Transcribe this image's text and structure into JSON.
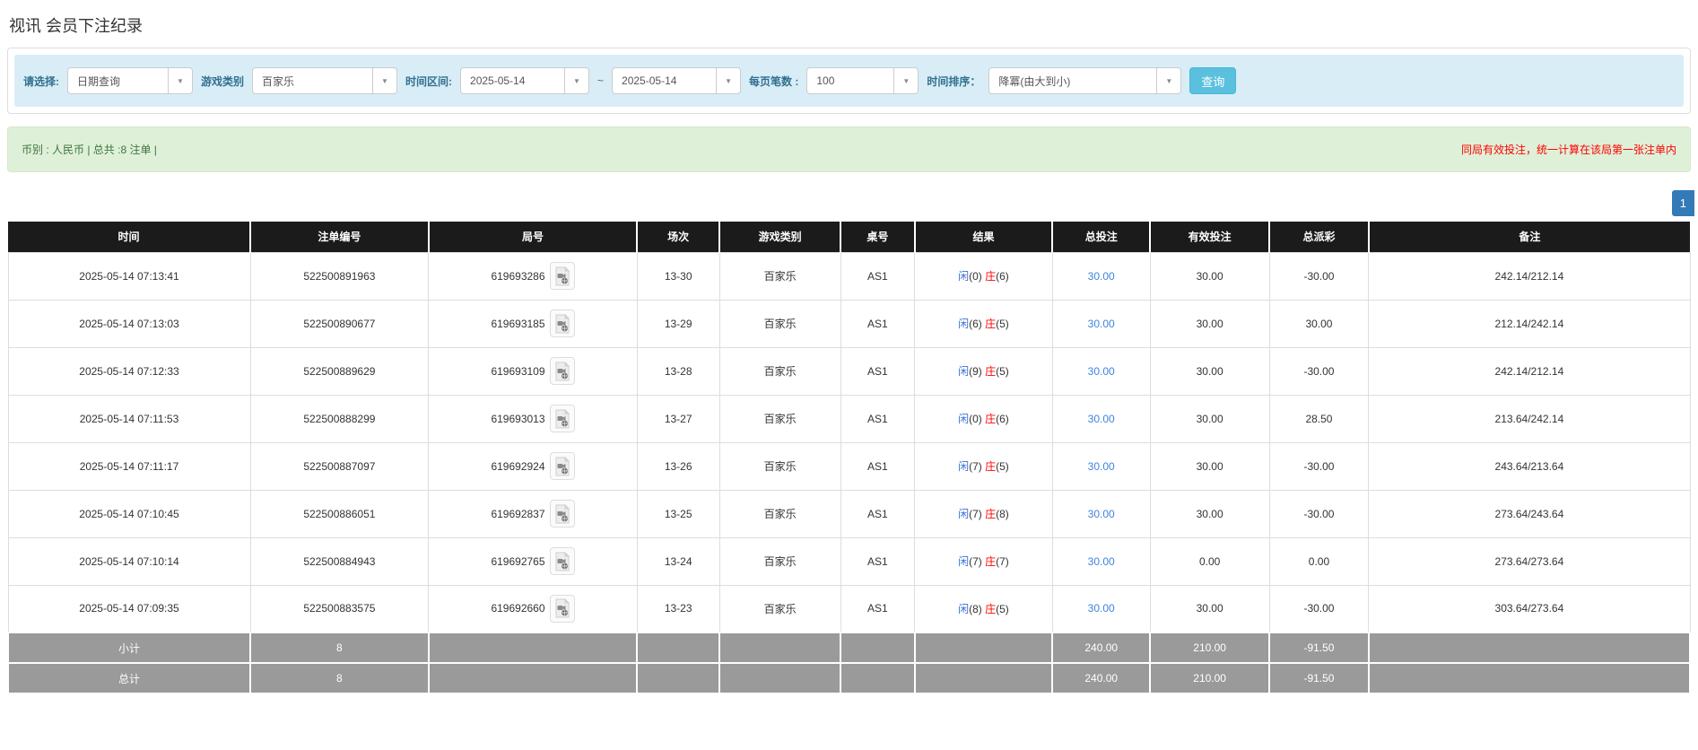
{
  "page": {
    "title": "视讯 会员下注纪录"
  },
  "filters": {
    "select_label": "请选择:",
    "select_value": "日期查询",
    "game_type_label": "游戏类别",
    "game_type_value": "百家乐",
    "time_range_label": "时间区间:",
    "date_from": "2025-05-14",
    "tilde": "~",
    "date_to": "2025-05-14",
    "page_size_label": "每页笔数 :",
    "page_size_value": "100",
    "sort_label": "时间排序：",
    "sort_value": "降冪(由大到小)",
    "search_button": "查询",
    "caret": "▼"
  },
  "summary": {
    "left_text": "币别 : 人民币 | 总共 :8 注单 |",
    "right_note": "同局有效投注，统一计算在该局第一张注单内"
  },
  "pagination": {
    "current_page": "1"
  },
  "table": {
    "headers": [
      "时间",
      "注单编号",
      "局号",
      "场次",
      "游戏类别",
      "桌号",
      "结果",
      "总投注",
      "有效投注",
      "总派彩",
      "备注"
    ],
    "rows": [
      {
        "time": "2025-05-14 07:13:41",
        "bet_id": "522500891963",
        "round_id": "619693286",
        "session": "13-30",
        "game": "百家乐",
        "table_no": "AS1",
        "result_player": "闲",
        "result_player_num": "(0)",
        "result_banker": "庄",
        "result_banker_num": "(6)",
        "total_bet": "30.00",
        "valid_bet": "30.00",
        "payout": "-30.00",
        "note": "242.14/212.14"
      },
      {
        "time": "2025-05-14 07:13:03",
        "bet_id": "522500890677",
        "round_id": "619693185",
        "session": "13-29",
        "game": "百家乐",
        "table_no": "AS1",
        "result_player": "闲",
        "result_player_num": "(6)",
        "result_banker": "庄",
        "result_banker_num": "(5)",
        "total_bet": "30.00",
        "valid_bet": "30.00",
        "payout": "30.00",
        "note": "212.14/242.14"
      },
      {
        "time": "2025-05-14 07:12:33",
        "bet_id": "522500889629",
        "round_id": "619693109",
        "session": "13-28",
        "game": "百家乐",
        "table_no": "AS1",
        "result_player": "闲",
        "result_player_num": "(9)",
        "result_banker": "庄",
        "result_banker_num": "(5)",
        "total_bet": "30.00",
        "valid_bet": "30.00",
        "payout": "-30.00",
        "note": "242.14/212.14"
      },
      {
        "time": "2025-05-14 07:11:53",
        "bet_id": "522500888299",
        "round_id": "619693013",
        "session": "13-27",
        "game": "百家乐",
        "table_no": "AS1",
        "result_player": "闲",
        "result_player_num": "(0)",
        "result_banker": "庄",
        "result_banker_num": "(6)",
        "total_bet": "30.00",
        "valid_bet": "30.00",
        "payout": "28.50",
        "note": "213.64/242.14"
      },
      {
        "time": "2025-05-14 07:11:17",
        "bet_id": "522500887097",
        "round_id": "619692924",
        "session": "13-26",
        "game": "百家乐",
        "table_no": "AS1",
        "result_player": "闲",
        "result_player_num": "(7)",
        "result_banker": "庄",
        "result_banker_num": "(5)",
        "total_bet": "30.00",
        "valid_bet": "30.00",
        "payout": "-30.00",
        "note": "243.64/213.64"
      },
      {
        "time": "2025-05-14 07:10:45",
        "bet_id": "522500886051",
        "round_id": "619692837",
        "session": "13-25",
        "game": "百家乐",
        "table_no": "AS1",
        "result_player": "闲",
        "result_player_num": "(7)",
        "result_banker": "庄",
        "result_banker_num": "(8)",
        "total_bet": "30.00",
        "valid_bet": "30.00",
        "payout": "-30.00",
        "note": "273.64/243.64"
      },
      {
        "time": "2025-05-14 07:10:14",
        "bet_id": "522500884943",
        "round_id": "619692765",
        "session": "13-24",
        "game": "百家乐",
        "table_no": "AS1",
        "result_player": "闲",
        "result_player_num": "(7)",
        "result_banker": "庄",
        "result_banker_num": "(7)",
        "total_bet": "30.00",
        "valid_bet": "0.00",
        "payout": "0.00",
        "note": "273.64/273.64"
      },
      {
        "time": "2025-05-14 07:09:35",
        "bet_id": "522500883575",
        "round_id": "619692660",
        "session": "13-23",
        "game": "百家乐",
        "table_no": "AS1",
        "result_player": "闲",
        "result_player_num": "(8)",
        "result_banker": "庄",
        "result_banker_num": "(5)",
        "total_bet": "30.00",
        "valid_bet": "30.00",
        "payout": "-30.00",
        "note": "303.64/273.64"
      }
    ],
    "subtotal": {
      "label": "小计",
      "count": "8",
      "total_bet": "240.00",
      "valid_bet": "210.00",
      "payout": "-91.50"
    },
    "total": {
      "label": "总计",
      "count": "8",
      "total_bet": "240.00",
      "valid_bet": "210.00",
      "payout": "-91.50"
    }
  },
  "icons": {
    "video_record_icon": "video-clip-file"
  },
  "colors": {
    "filter_bar_bg": "#d9edf7",
    "filter_label": "#31708f",
    "search_button_bg": "#5bc0de",
    "summary_bg": "#dff0d8",
    "summary_text": "#3c763d",
    "warning_red": "#ff0000",
    "table_header_bg": "#1b1b1b",
    "link_blue": "#3f83e0",
    "player_blue": "#3a6fd8",
    "banker_red": "#ff0000",
    "negative_red": "#ff0000",
    "subtotal_bg": "#9a9a9a",
    "pager_bg": "#337ab7"
  }
}
